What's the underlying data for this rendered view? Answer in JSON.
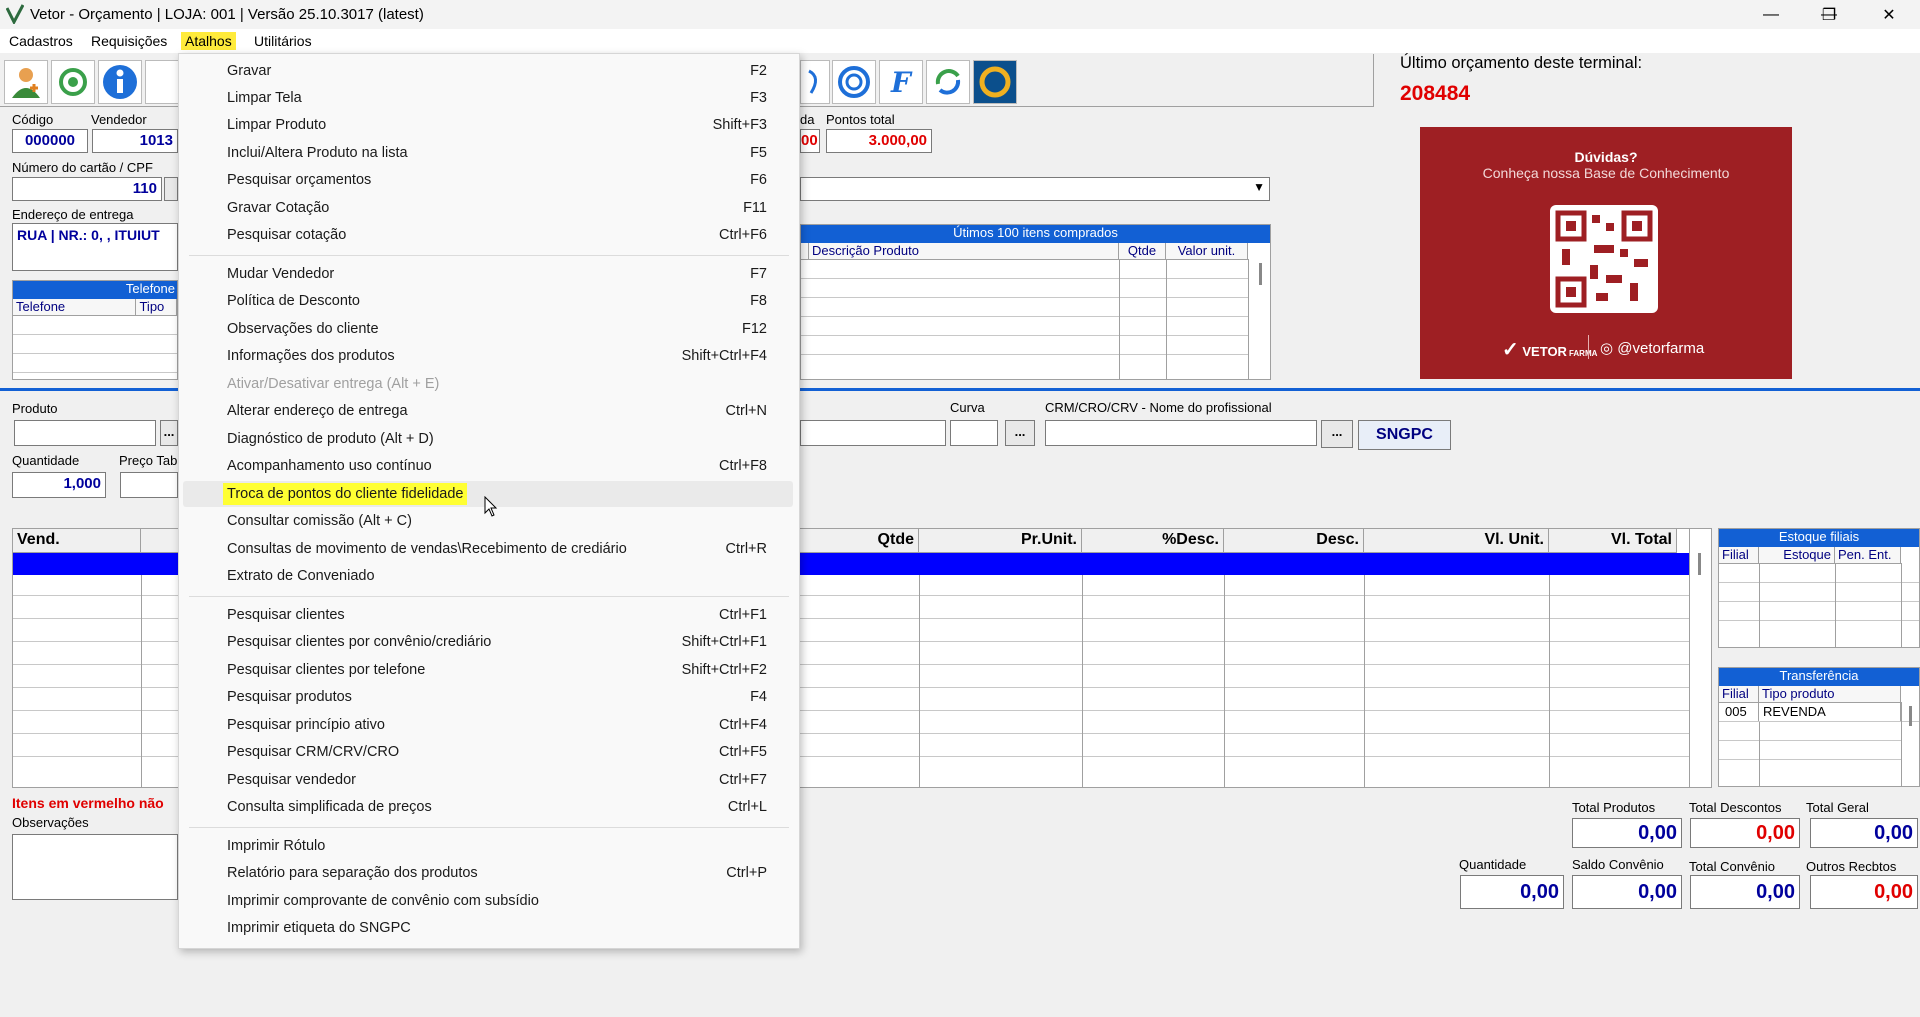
{
  "window": {
    "title": "Vetor - Orçamento     |     LOJA: 001     |     Versão 25.10.3017 (latest)",
    "minimize": "—",
    "maximize": "❐",
    "close": "✕"
  },
  "menubar": [
    "Cadastros",
    "Requisições",
    "Atalhos",
    "Utilitários"
  ],
  "header": {
    "codigo_label": "Código",
    "codigo_value": "000000",
    "vendedor_label": "Vendedor",
    "vendedor_value": "1013",
    "cartao_label": "Número do cartão / CPF",
    "cartao_value": "110",
    "endereco_label": "Endereço de entrega",
    "endereco_value": "RUA  |  NR.: 0, , ITUIUT",
    "pontos_label_partial": "da",
    "pontos_total_label": "Pontos total",
    "pontos_partial_value": "00",
    "pontos_total_value": "3.000,00",
    "ultimo_label": "Último orçamento deste terminal:",
    "ultimo_value": "208484"
  },
  "telefone_grid": {
    "title": "Telefone",
    "cols": [
      "Telefone",
      "Tipo"
    ]
  },
  "ultimos_grid": {
    "title": "Útimos 100 itens comprados",
    "cols": [
      "Descrição Produto",
      "Qtde",
      "Valor unit."
    ]
  },
  "ad": {
    "line1": "Dúvidas?",
    "line2": "Conheça nossa Base de Conhecimento",
    "brand": "VETOR",
    "brand_sub": "FARMA",
    "handle": "@vetorfarma"
  },
  "produto": {
    "produto_label": "Produto",
    "quantidade_label": "Quantidade",
    "quantidade_value": "1,000",
    "preco_label": "Preço Tab",
    "curva_label": "Curva",
    "crm_label": "CRM/CRO/CRV - Nome do profissional",
    "ellipsis": "...",
    "sngpc": "SNGPC"
  },
  "items_grid": {
    "cols": [
      "Vend.",
      "Qtde",
      "Pr.Unit.",
      "%Desc.",
      "Desc.",
      "Vl. Unit.",
      "Vl. Total"
    ]
  },
  "estoque": {
    "title": "Estoque filiais",
    "cols": [
      "Filial",
      "Estoque",
      "Pen. Ent."
    ]
  },
  "transferencia": {
    "title": "Transferência",
    "cols": [
      "Filial",
      "Tipo produto"
    ],
    "rows": [
      [
        "005",
        "REVENDA"
      ]
    ]
  },
  "footer": {
    "itens_vermelho": "Itens em vermelho não",
    "observacoes_label": "Observações",
    "total_produtos_label": "Total Produtos",
    "total_produtos": "0,00",
    "total_descontos_label": "Total Descontos",
    "total_descontos": "0,00",
    "total_geral_label": "Total Geral",
    "total_geral": "0,00",
    "quantidade_label": "Quantidade",
    "quantidade": "0,00",
    "saldo_convenio_label": "Saldo Convênio",
    "saldo_convenio": "0,00",
    "total_convenio_label": "Total Convênio",
    "total_convenio": "0,00",
    "outros_label": "Outros Recbtos",
    "outros": "0,00"
  },
  "atalhos_menu": [
    {
      "label": "Gravar",
      "key": "F2"
    },
    {
      "label": "Limpar Tela",
      "key": "F3"
    },
    {
      "label": "Limpar Produto",
      "key": "Shift+F3"
    },
    {
      "label": "Inclui/Altera Produto na lista",
      "key": "F5"
    },
    {
      "label": "Pesquisar orçamentos",
      "key": "F6"
    },
    {
      "label": "Gravar Cotação",
      "key": "F11"
    },
    {
      "label": "Pesquisar cotação",
      "key": "Ctrl+F6"
    },
    {
      "label": "Mudar Vendedor",
      "key": "F7"
    },
    {
      "label": "Política de Desconto",
      "key": "F8"
    },
    {
      "label": "Observações do cliente",
      "key": "F12"
    },
    {
      "label": "Informações dos produtos",
      "key": "Shift+Ctrl+F4"
    },
    {
      "label": "Ativar/Desativar entrega (Alt + E)",
      "key": ""
    },
    {
      "label": "Alterar endereço de entrega",
      "key": "Ctrl+N"
    },
    {
      "label": "Diagnóstico de produto (Alt + D)",
      "key": ""
    },
    {
      "label": "Acompanhamento uso contínuo",
      "key": "Ctrl+F8"
    },
    {
      "label": "Troca de pontos do cliente fidelidade",
      "key": ""
    },
    {
      "label": "Consultar comissão  (Alt + C)",
      "key": ""
    },
    {
      "label": "Consultas de movimento de vendas\\Recebimento de crediário",
      "key": "Ctrl+R"
    },
    {
      "label": "Extrato de Conveniado",
      "key": ""
    },
    {
      "label": "Pesquisar clientes",
      "key": "Ctrl+F1"
    },
    {
      "label": "Pesquisar clientes por convênio/crediário",
      "key": "Shift+Ctrl+F1"
    },
    {
      "label": "Pesquisar clientes por telefone",
      "key": "Shift+Ctrl+F2"
    },
    {
      "label": "Pesquisar produtos",
      "key": "F4"
    },
    {
      "label": "Pesquisar princípio ativo",
      "key": "Ctrl+F4"
    },
    {
      "label": "Pesquisar CRM/CRV/CRO",
      "key": "Ctrl+F5"
    },
    {
      "label": "Pesquisar vendedor",
      "key": "Ctrl+F7"
    },
    {
      "label": "Consulta simplificada de preços",
      "key": "Ctrl+L"
    },
    {
      "label": "Imprimir Rótulo",
      "key": ""
    },
    {
      "label": "Relatório para separação dos produtos",
      "key": "Ctrl+P"
    },
    {
      "label": "Imprimir comprovante de convênio com subsídio",
      "key": ""
    },
    {
      "label": "Imprimir etiqueta do SNGPC",
      "key": ""
    }
  ],
  "colors": {
    "accent": "#1260d4",
    "menu_highlight": "#ffeb3b",
    "value_blue": "#00009c",
    "value_red": "#e00000",
    "ad_bg": "#9e1f23"
  }
}
